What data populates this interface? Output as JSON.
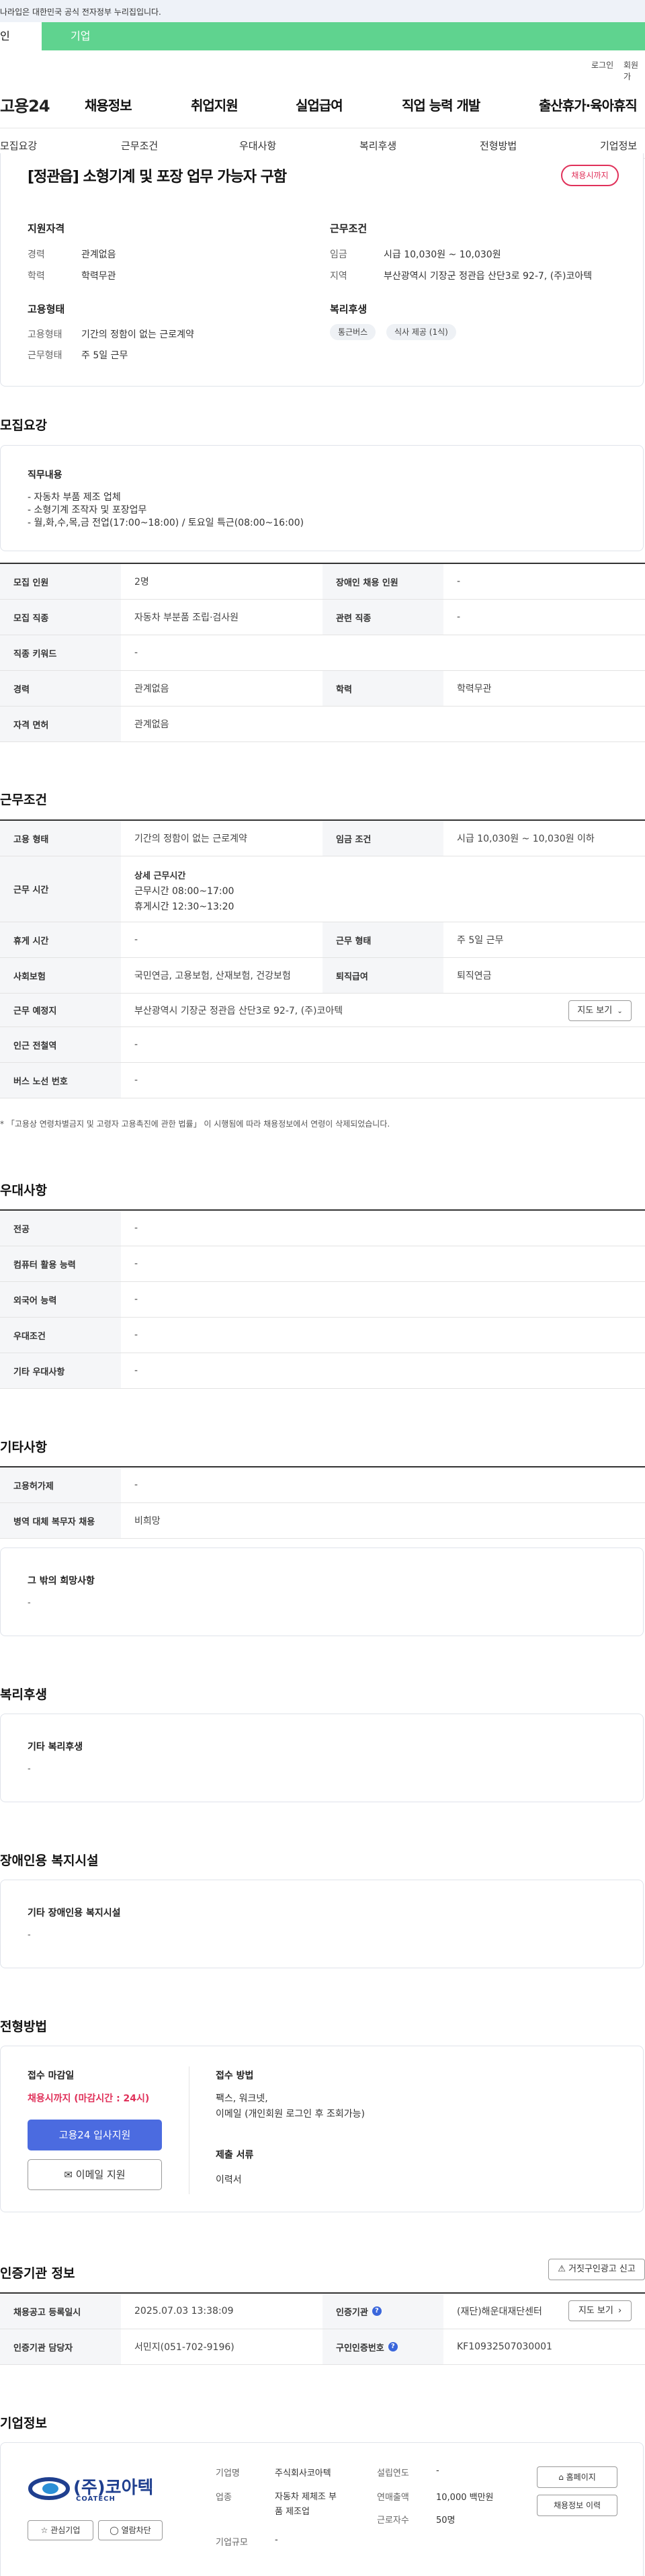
{
  "gov_banner": {
    "text": "나라입은 대한민국 공식 전자정부 누리집입니다."
  },
  "user_tabs": [
    {
      "label": "인"
    },
    {
      "label": "기업"
    }
  ],
  "util": {
    "login": "로그인",
    "signup": "회원가"
  },
  "header": {
    "logo": "고용24",
    "gnb": [
      "채용정보",
      "취업지원",
      "실업급여",
      "직업 능력 개발",
      "출산휴가·육아휴직"
    ]
  },
  "subnav": [
    "모집요강",
    "근무조건",
    "우대사항",
    "복리후생",
    "전형방법",
    "기업정보"
  ],
  "summary": {
    "title": "[정관읍] 소형기계 및 포장 업무 가능자 구함",
    "status": "채용시까지",
    "qual_title": "지원자격",
    "qual": [
      {
        "k": "경력",
        "v": "관계없음"
      },
      {
        "k": "학력",
        "v": "학력무관"
      }
    ],
    "work_title": "근무조건",
    "work": [
      {
        "k": "임금",
        "v": "시급 10,030원 ~ 10,030원"
      },
      {
        "k": "지역",
        "v": "부산광역시 기장군 정관읍 산단3로 92-7, (주)코아텍"
      }
    ],
    "emp_title": "고용형태",
    "emp": [
      {
        "k": "고용형태",
        "v": "기간의 정함이 없는 근로계약"
      },
      {
        "k": "근무형태",
        "v": "주 5일 근무"
      }
    ],
    "welfare_title": "복리후생",
    "welfare_chips": [
      "통근버스",
      "식사 제공 (1식)"
    ]
  },
  "recruit": {
    "title": "모집요강",
    "job_title": "직무내용",
    "job_lines": [
      "- 자동차 부품 제조 업체",
      "- 소형기계 조작자 및 포장업무",
      "- 월,화,수,목,금 전업(17:00~18:00) / 토요일 특근(08:00~16:00)"
    ],
    "table": [
      {
        "k1": "모집 인원",
        "v1": "2명",
        "k2": "장애인 채용 인원",
        "v2": "-"
      },
      {
        "k1": "모집 직종",
        "v1": "자동차 부분품 조립·검사원",
        "k2": "관련 직종",
        "v2": "-"
      },
      {
        "k1": "직종 키워드",
        "v1": "-"
      },
      {
        "k1": "경력",
        "v1": "관계없음",
        "k2": "학력",
        "v2": "학력무관"
      },
      {
        "k1": "자격 면허",
        "v1": "관계없음"
      }
    ]
  },
  "conditions": {
    "title": "근무조건",
    "row1": {
      "k1": "고용 형태",
      "v1": "기간의 정함이 없는 근로계약",
      "k2": "임금 조건",
      "v2": "시급 10,030원 ~ 10,030원 이하"
    },
    "row2": {
      "k1": "근무 시간",
      "title": "상세 근무시간",
      "lines": [
        "근무시간 08:00~17:00",
        "휴게시간 12:30~13:20"
      ]
    },
    "row3": {
      "k1": "휴게 시간",
      "v1": "-",
      "k2": "근무 형태",
      "v2": "주 5일 근무"
    },
    "row4": {
      "k1": "사회보험",
      "v1": "국민연금, 고용보험, 산재보험, 건강보험",
      "k2": "퇴직급여",
      "v2": "퇴직연금"
    },
    "row5": {
      "k1": "근무 예정지",
      "v1": "부산광역시 기장군 정관읍 산단3로 92-7, (주)코아텍",
      "btn": "지도 보기"
    },
    "row6": {
      "k1": "인근 전철역",
      "v1": "-"
    },
    "row7": {
      "k1": "버스 노선 번호",
      "v1": "-"
    },
    "note": "* 「고용상 연령차별금지 및 고령자 고용촉진에 관한 법률」 이 시행됨에 따라 채용정보에서 연령이 삭제되었습니다."
  },
  "preferences": {
    "title": "우대사항",
    "rows": [
      {
        "k": "전공",
        "v": "-"
      },
      {
        "k": "컴퓨터 활용 능력",
        "v": "-"
      },
      {
        "k": "외국어 능력",
        "v": "-"
      },
      {
        "k": "우대조건",
        "v": "-"
      },
      {
        "k": "기타 우대사항",
        "v": "-"
      }
    ]
  },
  "other": {
    "title": "기타사항",
    "rows": [
      {
        "k": "고용허가제",
        "v": "-"
      },
      {
        "k": "병역 대체 복무자 채용",
        "v": "비희망"
      }
    ],
    "box_title": "그 밖의 희망사항",
    "box_value": "-"
  },
  "welfare": {
    "title": "복리후생",
    "box_title": "기타 복리후생",
    "box_value": "-"
  },
  "disability": {
    "title": "장애인용 복지시설",
    "box_title": "기타 장애인용 복지시설",
    "box_value": "-"
  },
  "selection": {
    "title": "전형방법",
    "deadline_label": "접수 마감일",
    "deadline_value": "채용시까지 (마감시간 : 24시)",
    "apply_btn": "고용24 입사지원",
    "email_btn": "이메일 지원",
    "method_label": "접수 방법",
    "method_lines": [
      "팩스, 워크넷,",
      "이메일 (개인회원 로그인 후 조회가능)"
    ],
    "docs_label": "제출 서류",
    "docs_value": "이력서"
  },
  "agency": {
    "title": "인증기관 정보",
    "report_btn": "거짓구인광고 신고",
    "row1": {
      "k1": "채용공고 등록일시",
      "v1": "2025.07.03 13:38:09",
      "k2": "인증기관",
      "v2": "(재단)해운대재단센터",
      "btn": "지도 보기"
    },
    "row2": {
      "k1": "인증기관 담당자",
      "v1": "서민지(051-702-9196)",
      "k2": "구인인증번호",
      "v2": "KF10932507030001"
    }
  },
  "company": {
    "title": "기업정보",
    "logo_text": "(주)코아텍",
    "logo_sub": "COATECH",
    "fav_btn": "관심기업",
    "block_btn": "열람차단",
    "fields": {
      "name_k": "기업명",
      "name_v": "주식회사코아텍",
      "industry_k": "업종",
      "industry_v1": "자동차 제체조 부",
      "industry_v2": "품 제조업",
      "size_k": "기업규모",
      "size_v": "-",
      "founded_k": "설립연도",
      "founded_v": "-",
      "sales_k": "연매출액",
      "sales_v": "10,000 백만원",
      "staff_k": "근로자수",
      "staff_v": "50명"
    },
    "homepage_btn": "홈페이지",
    "jobs_btn": "채용정보 이력"
  },
  "colors": {
    "brand_green": "#5fd38f",
    "accent_blue": "#4b6be0",
    "alert_red": "#e0315a"
  }
}
